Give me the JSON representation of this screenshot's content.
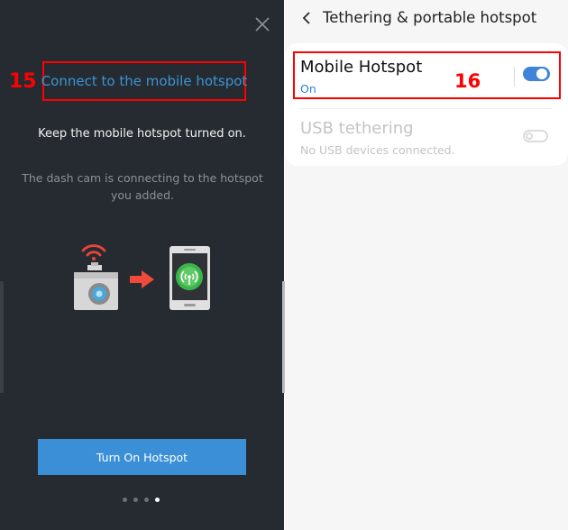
{
  "left": {
    "step_number": "15",
    "title": "Connect to the mobile hotspot",
    "keep_text": "Keep the mobile hotspot turned on.",
    "connecting_text": "The dash cam is connecting to the hotspot you added.",
    "button_label": "Turn On Hotspot",
    "pager": {
      "total": 4,
      "active_index": 3
    }
  },
  "right": {
    "header_title": "Tethering & portable hotspot",
    "step_number": "16",
    "mobile_hotspot": {
      "label": "Mobile Hotspot",
      "status": "On",
      "enabled": true
    },
    "usb_tethering": {
      "label": "USB tethering",
      "status": "No USB devices connected.",
      "enabled": false
    }
  },
  "colors": {
    "accent_blue": "#3a8fd6",
    "annotation_red": "#ff0000",
    "wifi_red": "#e8453c",
    "hotspot_green": "#3bb54a"
  },
  "icons": [
    "close-icon",
    "wifi-icon",
    "dash-cam-icon",
    "arrow-right-icon",
    "phone-icon",
    "hotspot-signal-icon",
    "back-chevron-icon"
  ]
}
